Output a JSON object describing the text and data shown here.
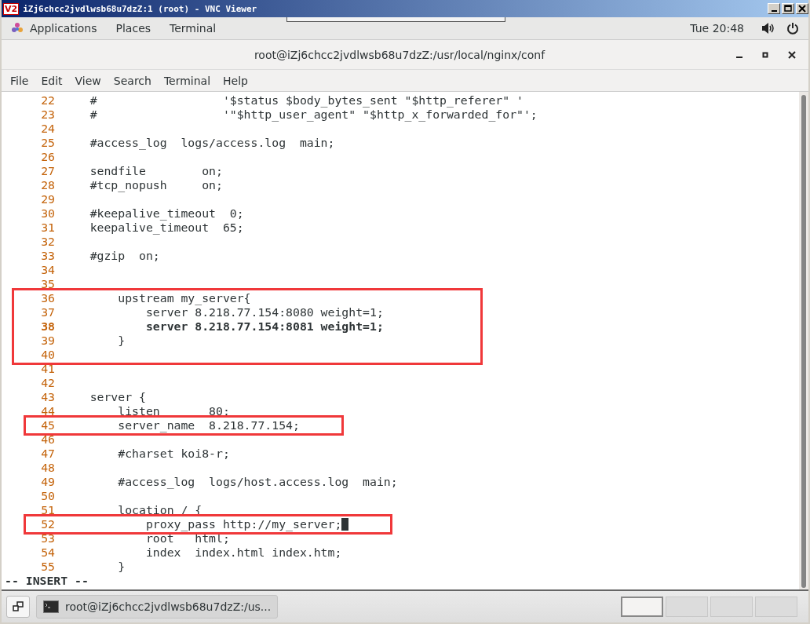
{
  "vnc_window": {
    "logo": "V2",
    "title": "iZj6chcc2jvdlwsb68u7dzZ:1 (root) - VNC Viewer"
  },
  "top_bar": {
    "menus": [
      "Applications",
      "Places",
      "Terminal"
    ],
    "clock": "Tue 20:48"
  },
  "terminal": {
    "title": "root@iZj6chcc2jvdlwsb68u7dzZ:/usr/local/nginx/conf",
    "menu": [
      "File",
      "Edit",
      "View",
      "Search",
      "Terminal",
      "Help"
    ],
    "blocks": [
      {
        "boxed": false,
        "lines": [
          {
            "n": "22",
            "text": "    #                  '$status $body_bytes_sent \"$http_referer\" '"
          },
          {
            "n": "23",
            "text": "    #                  '\"$http_user_agent\" \"$http_x_forwarded_for\"';"
          },
          {
            "n": "24"
          },
          {
            "n": "25",
            "text": "    #access_log  logs/access.log  main;"
          },
          {
            "n": "26"
          },
          {
            "n": "27",
            "text": "    sendfile        on;"
          },
          {
            "n": "28",
            "text": "    #tcp_nopush     on;"
          },
          {
            "n": "29"
          },
          {
            "n": "30",
            "text": "    #keepalive_timeout  0;"
          },
          {
            "n": "31",
            "text": "    keepalive_timeout  65;"
          },
          {
            "n": "32"
          },
          {
            "n": "33",
            "text": "    #gzip  on;"
          },
          {
            "n": "34"
          },
          {
            "n": "35"
          }
        ]
      },
      {
        "boxed": true,
        "lines": [
          {
            "n": "36",
            "text": "        upstream my_server{"
          },
          {
            "n": "37",
            "text": "            server 8.218.77.154:8080 weight=1;"
          },
          {
            "n": "38",
            "text": "            server 8.218.77.154:8081 weight=1;",
            "bold": true
          },
          {
            "n": "39",
            "text": "        }"
          },
          {
            "n": "40"
          }
        ]
      },
      {
        "boxed": false,
        "lines": [
          {
            "n": "41"
          },
          {
            "n": "42"
          },
          {
            "n": "43",
            "text": "    server {"
          },
          {
            "n": "44",
            "text": "        listen       80;"
          }
        ]
      },
      {
        "boxed": true,
        "lines": [
          {
            "n": "45",
            "text": "        server_name  8.218.77.154;"
          }
        ]
      },
      {
        "boxed": false,
        "lines": [
          {
            "n": "46"
          },
          {
            "n": "47",
            "text": "        #charset koi8-r;"
          },
          {
            "n": "48"
          },
          {
            "n": "49",
            "text": "        #access_log  logs/host.access.log  main;"
          },
          {
            "n": "50"
          },
          {
            "n": "51",
            "text": "        location / {"
          }
        ]
      },
      {
        "boxed": true,
        "lines": [
          {
            "n": "52",
            "text": "            proxy_pass http://my_server;",
            "cursor": true
          }
        ]
      },
      {
        "boxed": false,
        "lines": [
          {
            "n": "53",
            "text": "            root   html;"
          },
          {
            "n": "54",
            "text": "            index  index.html index.htm;"
          },
          {
            "n": "55",
            "text": "        }"
          }
        ]
      }
    ],
    "mode": "-- INSERT --"
  },
  "taskbar": {
    "task": "root@iZj6chcc2jvdlwsb68u7dzZ:/us...",
    "workspaces": [
      {
        "selected": true
      },
      {
        "selected": false
      },
      {
        "selected": false
      },
      {
        "selected": false
      }
    ]
  }
}
